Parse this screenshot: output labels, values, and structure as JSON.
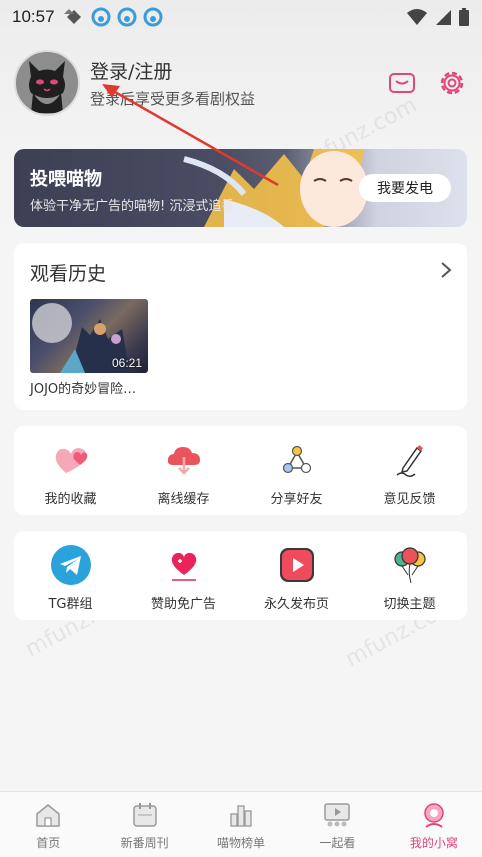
{
  "status_bar": {
    "time": "10:57"
  },
  "profile": {
    "title": "登录/注册",
    "subtitle": "登录后享受更多看剧权益"
  },
  "banner": {
    "title": "投喂喵物",
    "subtitle": "体验干净无广告的喵物! 沉浸式追番",
    "button": "我要发电"
  },
  "history": {
    "title": "观看历史",
    "items": [
      {
        "caption": "JOJO的奇妙冒险…",
        "duration": "06:21"
      }
    ]
  },
  "features_row1": [
    {
      "label": "我的收藏",
      "icon": "heart-icon"
    },
    {
      "label": "离线缓存",
      "icon": "cloud-download-icon"
    },
    {
      "label": "分享好友",
      "icon": "share-icon"
    },
    {
      "label": "意见反馈",
      "icon": "feedback-pen-icon"
    }
  ],
  "features_row2": [
    {
      "label": "TG群组",
      "icon": "telegram-icon"
    },
    {
      "label": "赞助免广告",
      "icon": "sponsor-heart-icon"
    },
    {
      "label": "永久发布页",
      "icon": "play-icon"
    },
    {
      "label": "切换主题",
      "icon": "balloons-icon"
    }
  ],
  "bottom_nav": [
    {
      "label": "首页",
      "icon": "home-icon"
    },
    {
      "label": "新番周刊",
      "icon": "calendar-icon"
    },
    {
      "label": "喵物榜单",
      "icon": "ranking-icon"
    },
    {
      "label": "一起看",
      "icon": "watch-together-icon"
    },
    {
      "label": "我的小窝",
      "icon": "profile-icon",
      "active": true
    }
  ],
  "watermark": "mfunz.com",
  "colors": {
    "accent": "#e0457b",
    "banner_dark": "#3d3f55",
    "annotation": "#e03a2f"
  }
}
